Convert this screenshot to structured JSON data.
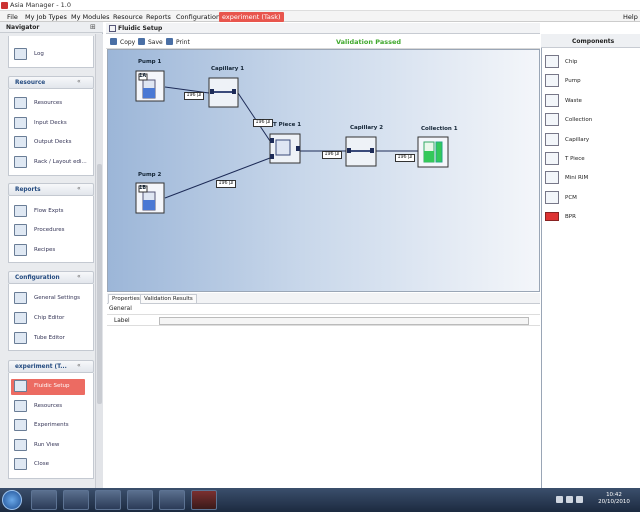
{
  "window": {
    "title": "Asia Manager - 1.0"
  },
  "menu": {
    "items": [
      "File",
      "My Job Types",
      "My Modules",
      "Resource",
      "Reports",
      "Configuration",
      "experiment (Task)"
    ],
    "help": "Help"
  },
  "navigator": {
    "title": "Navigator",
    "log_label": "Log",
    "sections": {
      "resource": {
        "title": "Resource",
        "items": [
          "Resources",
          "Input Decks",
          "Output Decks",
          "Rack / Layout edi..."
        ]
      },
      "reports": {
        "title": "Reports",
        "items": [
          "Flow Expts",
          "Procedures",
          "Recipes"
        ]
      },
      "configuration": {
        "title": "Configuration",
        "items": [
          "General Settings",
          "Chip Editor",
          "Tube Editor"
        ]
      },
      "experiment": {
        "title": "experiment (T...",
        "items": [
          "Fluidic Setup",
          "Resources",
          "Experiments",
          "Run View",
          "Close"
        ]
      }
    }
  },
  "document": {
    "tab_title": "Fluidic Setup"
  },
  "toolbar": {
    "copy": "Copy",
    "save": "Save",
    "print": "Print",
    "validation": "Validation Passed"
  },
  "canvas": {
    "nodes": {
      "pump1": {
        "label": "Pump 1",
        "badge": "1A"
      },
      "pump2": {
        "label": "Pump 2",
        "badge": "1B"
      },
      "capillary1": {
        "label": "Capillary 1"
      },
      "tpiece1": {
        "label": "T Piece 1"
      },
      "capillary2": {
        "label": "Capillary 2"
      },
      "collection1": {
        "label": "Collection 1"
      }
    },
    "volumes": {
      "v1": "196 µl",
      "v2": "196 µl",
      "v3": "196 µl",
      "v4": "196 µl",
      "v5": "196 µl"
    }
  },
  "properties": {
    "tabs": [
      "Properties",
      "Validation Results"
    ],
    "group": "General",
    "label_field": "Label",
    "label_value": ""
  },
  "components": {
    "title": "Components",
    "items": [
      "Chip",
      "Pump",
      "Waste",
      "Collection",
      "Capillary",
      "T Piece",
      "Mini RIM",
      "PCM",
      "BPR"
    ]
  },
  "taskbar": {
    "time": "10:42",
    "date": "20/10/2010"
  },
  "colors": {
    "accent": "#e8554d",
    "validation": "#3fa82c",
    "canvas_left": "#9cb6d8",
    "canvas_right": "#f4f6fa"
  }
}
